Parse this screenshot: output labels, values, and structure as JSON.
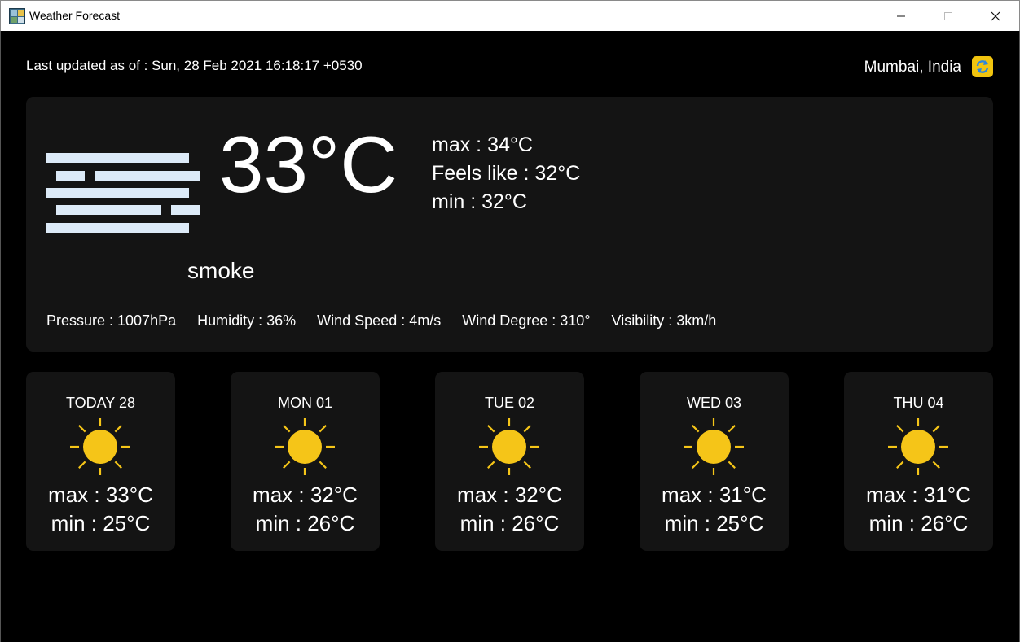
{
  "window": {
    "title": "Weather Forecast",
    "controls": [
      "minimize-icon",
      "maximize-icon",
      "close-icon"
    ]
  },
  "header": {
    "last_updated": "Last updated as of : Sun, 28 Feb 2021 16:18:17 +0530",
    "location": "Mumbai, India",
    "refresh_icon": "refresh-icon"
  },
  "current": {
    "icon": "smoke-icon",
    "temperature": "33°C",
    "max": "max : 34°C",
    "feels_like": "Feels like : 32°C",
    "min": "min : 32°C",
    "condition": "smoke",
    "stats": {
      "pressure": "Pressure : 1007hPa",
      "humidity": "Humidity : 36%",
      "wind_speed": "Wind Speed : 4m/s",
      "wind_degree": "Wind Degree : 310°",
      "visibility": "Visibility : 3km/h"
    }
  },
  "forecast": [
    {
      "day": "TODAY 28",
      "icon": "sun-icon",
      "max": "max : 33°C",
      "min": "min : 25°C"
    },
    {
      "day": "MON 01",
      "icon": "sun-icon",
      "max": "max : 32°C",
      "min": "min : 26°C"
    },
    {
      "day": "TUE 02",
      "icon": "sun-icon",
      "max": "max : 32°C",
      "min": "min : 26°C"
    },
    {
      "day": "WED 03",
      "icon": "sun-icon",
      "max": "max : 31°C",
      "min": "min : 25°C"
    },
    {
      "day": "THU 04",
      "icon": "sun-icon",
      "max": "max : 31°C",
      "min": "min : 26°C"
    }
  ],
  "colors": {
    "background": "#000000",
    "card": "#141414",
    "sun": "#f5c518",
    "smoke": "#dceaf7",
    "refresh_button": "#f1c40f"
  }
}
